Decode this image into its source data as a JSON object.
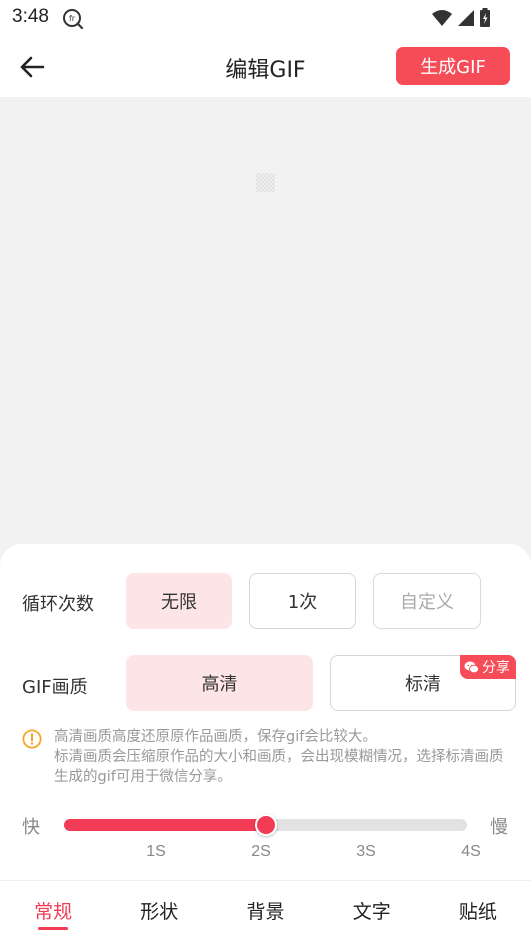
{
  "status_bar": {
    "time": "3:48",
    "icons": [
      "fr-icon",
      "wifi-icon",
      "signal-icon",
      "battery-icon"
    ]
  },
  "app_bar": {
    "title": "编辑GIF",
    "generate_label": "生成GIF",
    "back_icon": "arrow-left-icon"
  },
  "loop": {
    "label": "循环次数",
    "options": [
      {
        "label": "无限",
        "selected": true
      },
      {
        "label": "1次",
        "selected": false
      },
      {
        "label": "自定义",
        "selected": false
      }
    ]
  },
  "quality": {
    "label": "GIF画质",
    "options": [
      {
        "label": "高清",
        "selected": true
      },
      {
        "label": "标清",
        "selected": false,
        "badge": "分享"
      }
    ]
  },
  "notice": {
    "line1": "高清画质高度还原原作品画质，保存gif会比较大。",
    "line2": "标清画质会压缩原作品的大小和画质，会出现模糊情况，选择标清画质生成的gif可用于微信分享。"
  },
  "speed": {
    "fast_label": "快",
    "slow_label": "慢",
    "ticks": [
      "1S",
      "2S",
      "3S",
      "4S"
    ],
    "value": "2S",
    "progress": 0.5
  },
  "tabs": [
    {
      "label": "常规",
      "active": true
    },
    {
      "label": "形状",
      "active": false
    },
    {
      "label": "背景",
      "active": false
    },
    {
      "label": "文字",
      "active": false
    },
    {
      "label": "贴纸",
      "active": false
    }
  ],
  "colors": {
    "accent": "#f23c56",
    "button": "#f64c58",
    "selected_bg": "#fde4e7",
    "notice_icon": "#f5a623"
  }
}
